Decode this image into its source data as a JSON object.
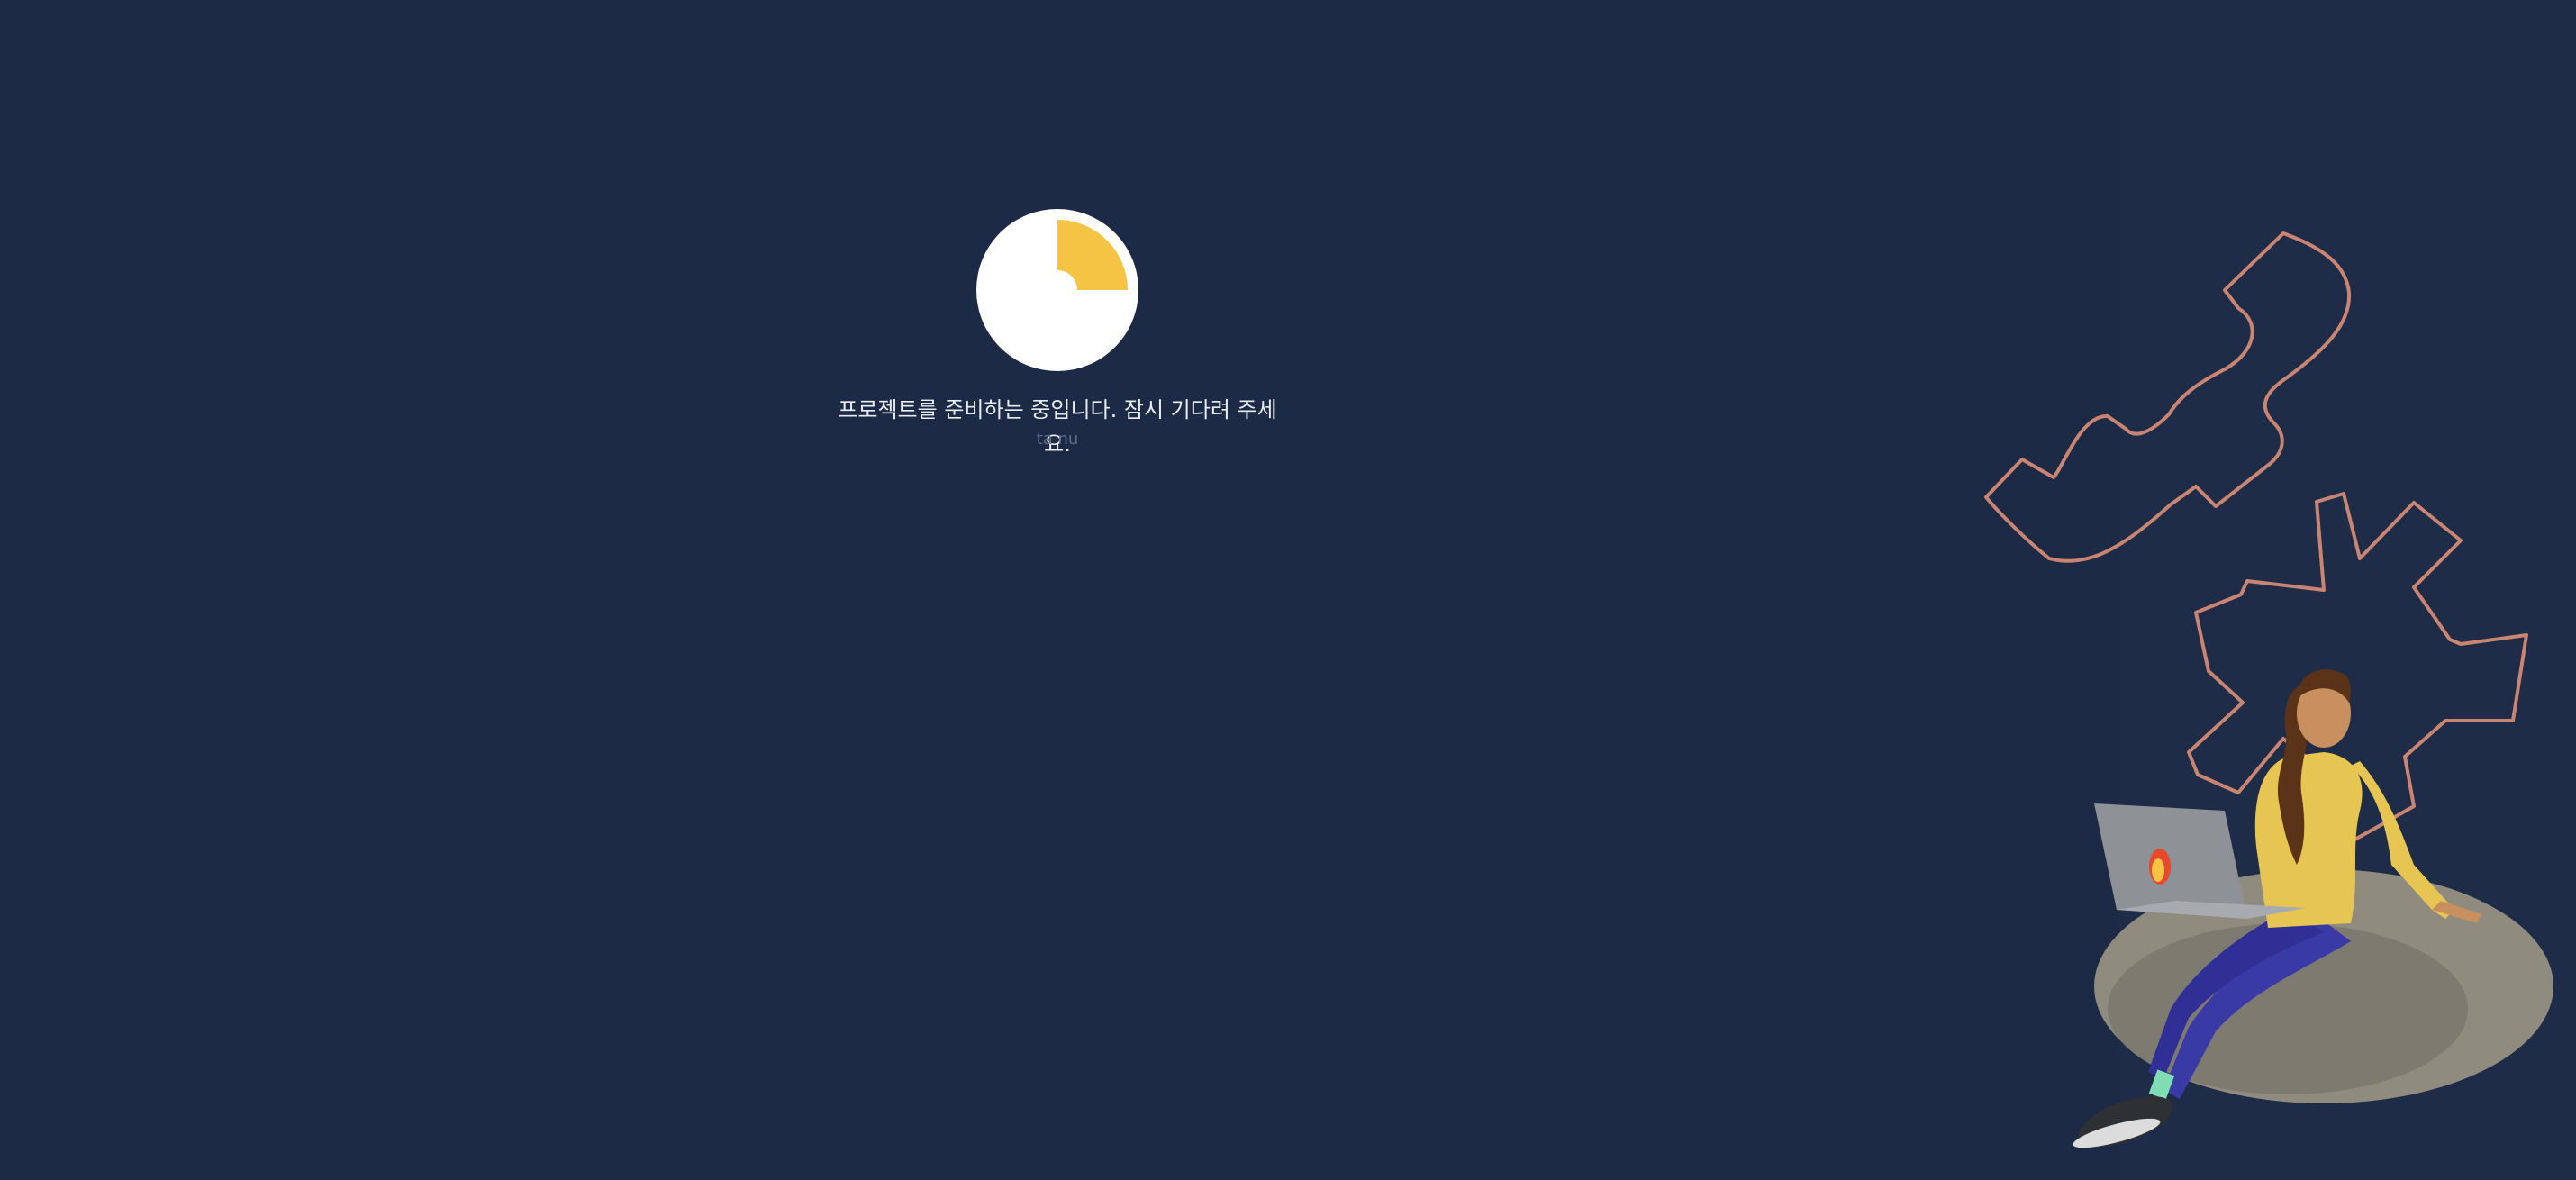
{
  "loader": {
    "message": "프로젝트를 준비하는 중입니다. 잠시 기다려 주세요.",
    "faint_label": "ta nu",
    "progress_fraction": 0.25,
    "accent_color": "#f6c445",
    "spinner_bg": "#ffffff"
  },
  "page": {
    "background": "#1c2a45"
  },
  "illustration": {
    "icon": "person-on-beanbag-with-laptop-illustration",
    "decoration": "abstract-outline-shapes"
  }
}
